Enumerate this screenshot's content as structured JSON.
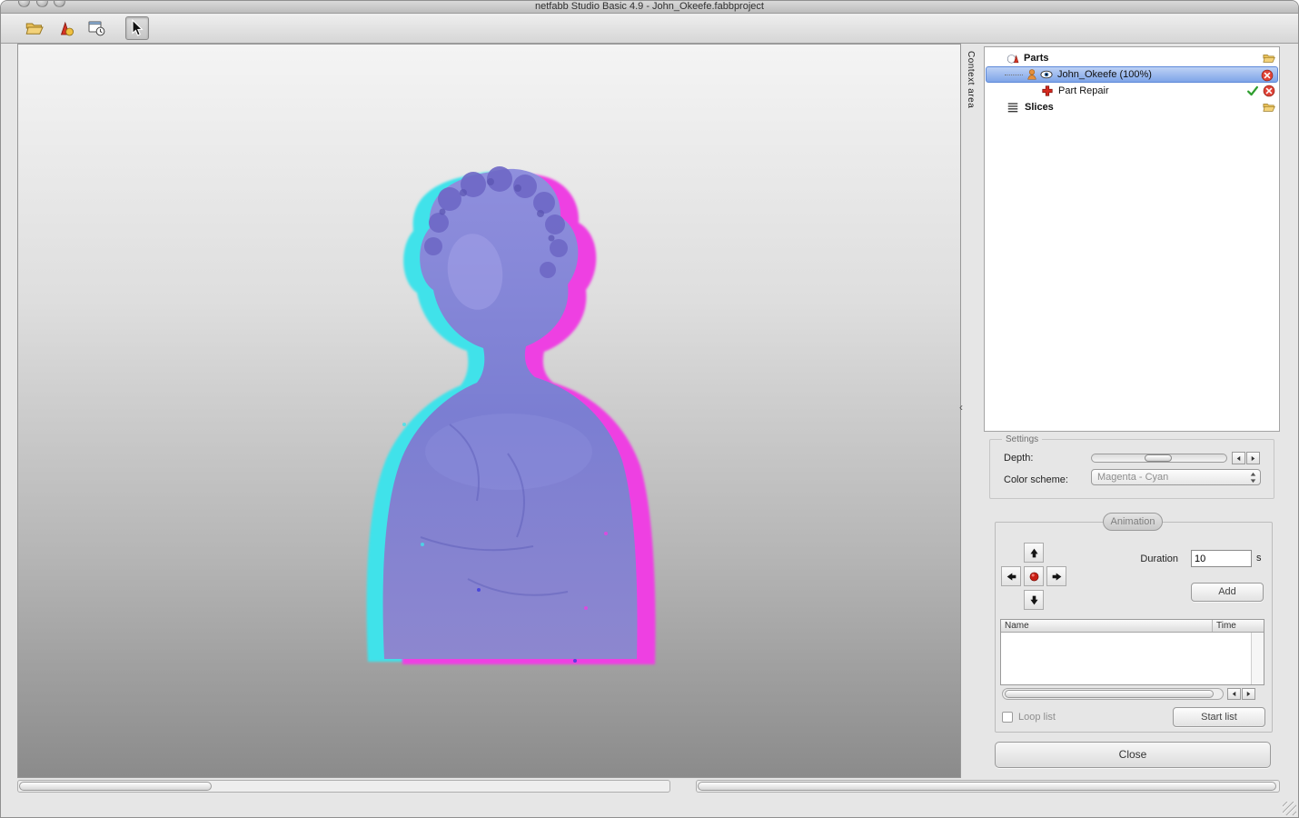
{
  "window": {
    "title": "netfabb Studio Basic 4.9 - John_Okeefe.fabbproject"
  },
  "context": {
    "label": "Context area"
  },
  "tree": {
    "parts_label": "Parts",
    "selected_part": "John_Okeefe (100%)",
    "part_repair_label": "Part Repair",
    "slices_label": "Slices"
  },
  "settings": {
    "title": "Settings",
    "depth_label": "Depth:",
    "color_scheme_label": "Color scheme:",
    "color_scheme_value": "Magenta - Cyan"
  },
  "animation": {
    "title": "Animation",
    "duration_label": "Duration",
    "duration_value": "10",
    "duration_unit": "s",
    "add_label": "Add",
    "table": {
      "columns": [
        "Name",
        "Time"
      ]
    },
    "loop_list_label": "Loop list",
    "start_list_label": "Start list"
  },
  "footer": {
    "close_label": "Close"
  },
  "colors": {
    "selection_blue": "#5b87d8",
    "anaglyph_cyan": "#41e2ea",
    "anaglyph_magenta": "#ee3fe2",
    "model_blue": "#7b7ed2",
    "record_red": "#c81e14"
  },
  "icons": {
    "toolbar": [
      "open-folder-icon",
      "add-parts-icon",
      "project-window-icon",
      "cursor-tool-icon"
    ],
    "tree": [
      "parts-icon",
      "open-folder-icon",
      "part-icon",
      "visibility-eye-icon",
      "remove-icon",
      "repair-cross-icon",
      "apply-check-icon",
      "slices-icon"
    ]
  }
}
